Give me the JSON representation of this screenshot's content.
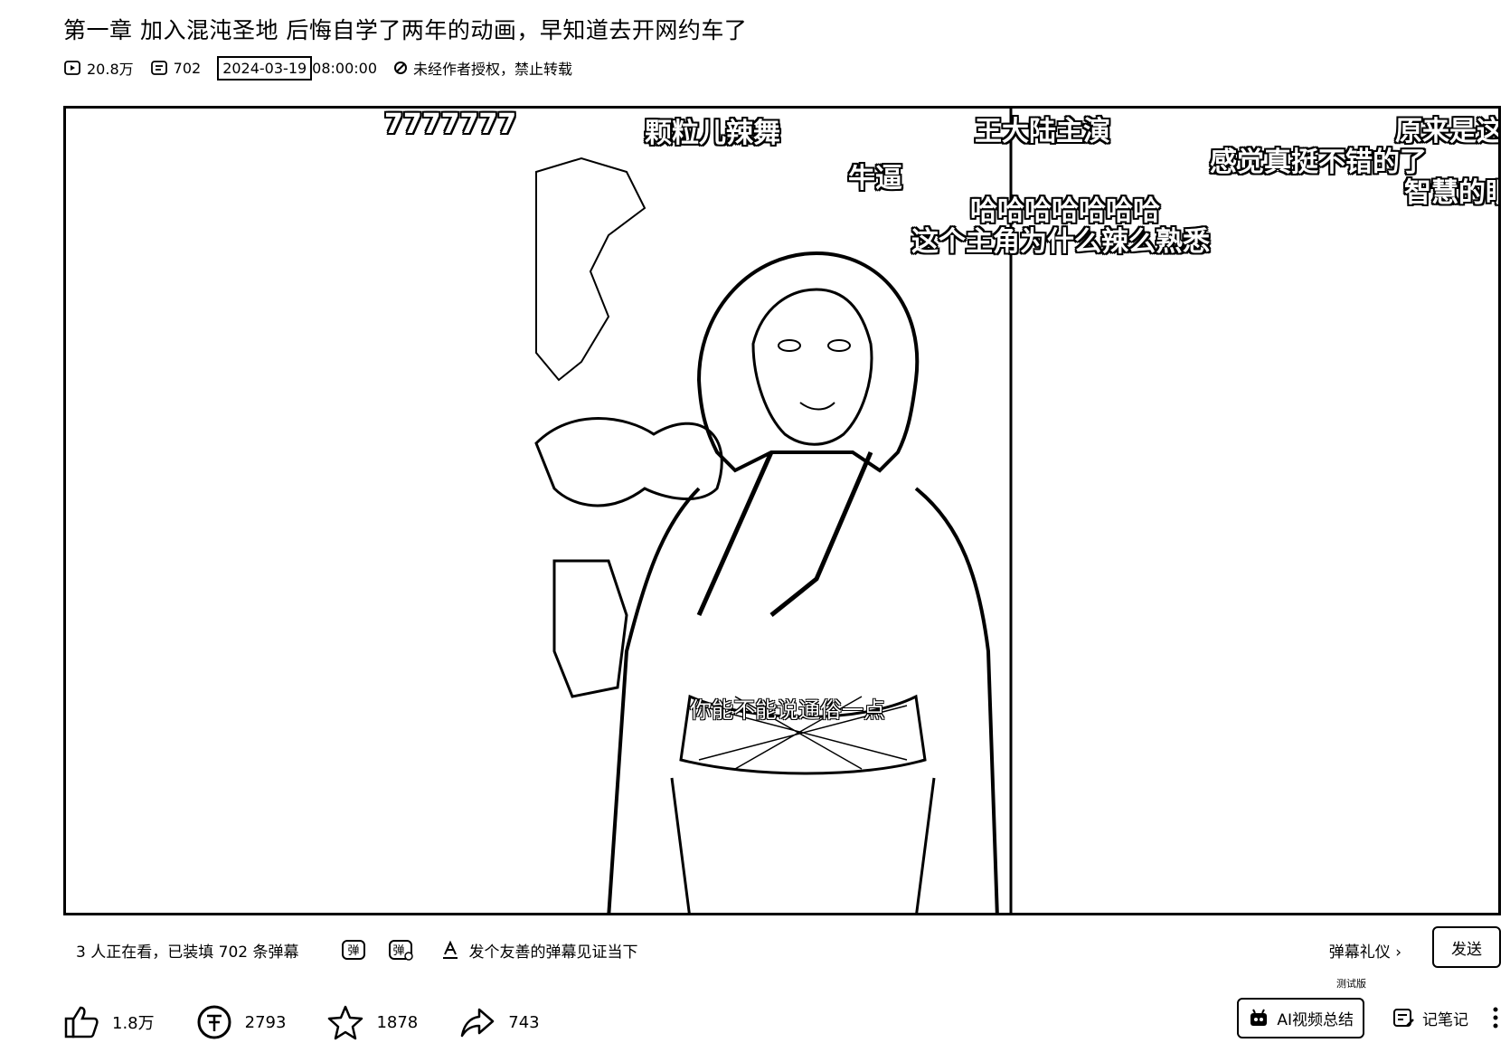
{
  "video": {
    "title": "第一章 加入混沌圣地 后悔自学了两年的动画，早知道去开网约车了",
    "views": "20.8万",
    "danmaku_count": "702",
    "date": "2024-03-19",
    "time": "08:00:00",
    "copyright": "未经作者授权，禁止转载"
  },
  "player": {
    "subtitle": "你能不能说通俗一点",
    "danmaku": [
      "7777777",
      "颗粒儿辣舞",
      "牛逼",
      "王大陆主演",
      "原来是这",
      "感觉真挺不错的了",
      "智慧的眼",
      "哈哈哈哈哈哈哈",
      "这个主角为什么辣么熟悉"
    ]
  },
  "danmaku_bar": {
    "status": "3 人正在看，已装填 702 条弹幕",
    "input_placeholder": "发个友善的弹幕见证当下",
    "etiquette": "弹幕礼仪 ›",
    "send": "发送"
  },
  "actions": {
    "like": "1.8万",
    "coin": "2793",
    "favorite": "1878",
    "share": "743",
    "ai_summary": "AI视频总结",
    "ai_badge": "测试版",
    "notes": "记笔记"
  }
}
